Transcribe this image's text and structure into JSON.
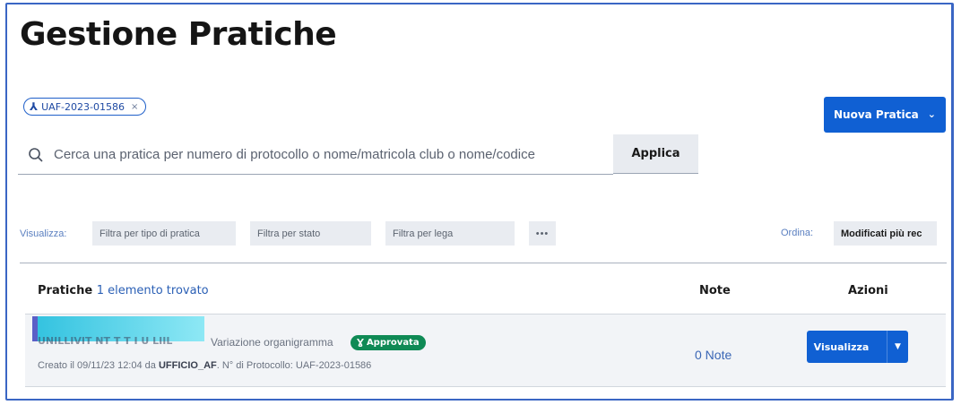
{
  "page": {
    "title": "Gestione Pratiche"
  },
  "active_filter_chip": {
    "icon": "organization-icon",
    "label": "UAF-2023-01586",
    "remove": "×"
  },
  "actions": {
    "new_button": "Nuova Pratica"
  },
  "search": {
    "placeholder": "Cerca una pratica per numero di protocollo o nome/matricola club o nome/codice",
    "apply_label": "Applica"
  },
  "filters": {
    "label": "Visualizza:",
    "type": "Filtra per tipo di pratica",
    "state": "Filtra per stato",
    "league": "Filtra per lega",
    "more": "•••"
  },
  "sort": {
    "label": "Ordina:",
    "value": "Modificati più rec"
  },
  "table": {
    "col_pratiche": "Pratiche",
    "count_text": "1 elemento trovato",
    "col_note": "Note",
    "col_azioni": "Azioni"
  },
  "rows": [
    {
      "name_partial": "UNILLIVIT NT T T I U LIIL",
      "type": "Variazione organigramma",
      "status": "Approvata",
      "created_prefix": "Creato il 09/11/23 12:04 da",
      "created_by": "UFFICIO_AF",
      "protocol": ". N° di Protocollo: UAF-2023-01586",
      "notes": "0 Note",
      "view_label": "Visualizza"
    }
  ],
  "colors": {
    "accent": "#1060d3",
    "status_approved": "#0f8a55",
    "frame": "#3a66c4"
  }
}
